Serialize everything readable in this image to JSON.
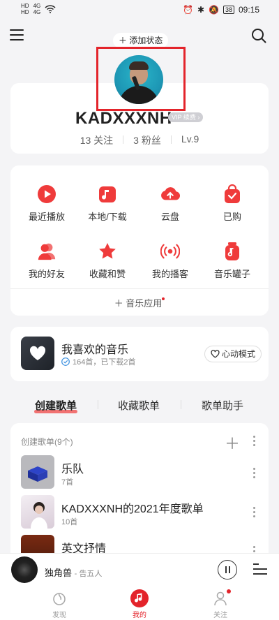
{
  "status_bar": {
    "sim1": "HD",
    "sim2": "HD",
    "net1": "4G",
    "net2": "4G",
    "battery": "38",
    "time": "09:15"
  },
  "header": {
    "add_status": "＋ 添加状态"
  },
  "profile": {
    "username": "KADXXXNH",
    "vip_badge": "VIP 续费 ›",
    "following": "13 关注",
    "followers": "3 粉丝",
    "level": "Lv.9"
  },
  "grid": [
    {
      "label": "最近播放",
      "icon": "play-icon"
    },
    {
      "label": "本地/下载",
      "icon": "music-note-icon"
    },
    {
      "label": "云盘",
      "icon": "cloud-upload-icon"
    },
    {
      "label": "已购",
      "icon": "purchased-bag-icon"
    },
    {
      "label": "我的好友",
      "icon": "friends-icon"
    },
    {
      "label": "收藏和赞",
      "icon": "star-icon"
    },
    {
      "label": "我的播客",
      "icon": "broadcast-icon"
    },
    {
      "label": "音乐罐子",
      "icon": "music-jar-icon"
    }
  ],
  "music_app": "＋ 音乐应用",
  "favorite": {
    "title": "我喜欢的音乐",
    "subtitle": "164首，已下载2首",
    "mode_button": "心动模式"
  },
  "tabs": [
    "创建歌单",
    "收藏歌单",
    "歌单助手"
  ],
  "playlists": {
    "header": "创建歌单(9个)",
    "items": [
      {
        "name": "乐队",
        "count": "7首"
      },
      {
        "name": "KADXXXNH的2021年度歌单",
        "count": "10首"
      },
      {
        "name": "英文抒情",
        "count": ""
      }
    ]
  },
  "player": {
    "title": "独角兽",
    "artist": "- 告五人"
  },
  "nav": [
    {
      "label": "发现",
      "icon": "discover-icon"
    },
    {
      "label": "我的",
      "icon": "my-music-icon"
    },
    {
      "label": "关注",
      "icon": "follow-icon"
    }
  ],
  "colors": {
    "accent": "#e3242b",
    "background": "#f4f4f6",
    "card": "#ffffff"
  }
}
